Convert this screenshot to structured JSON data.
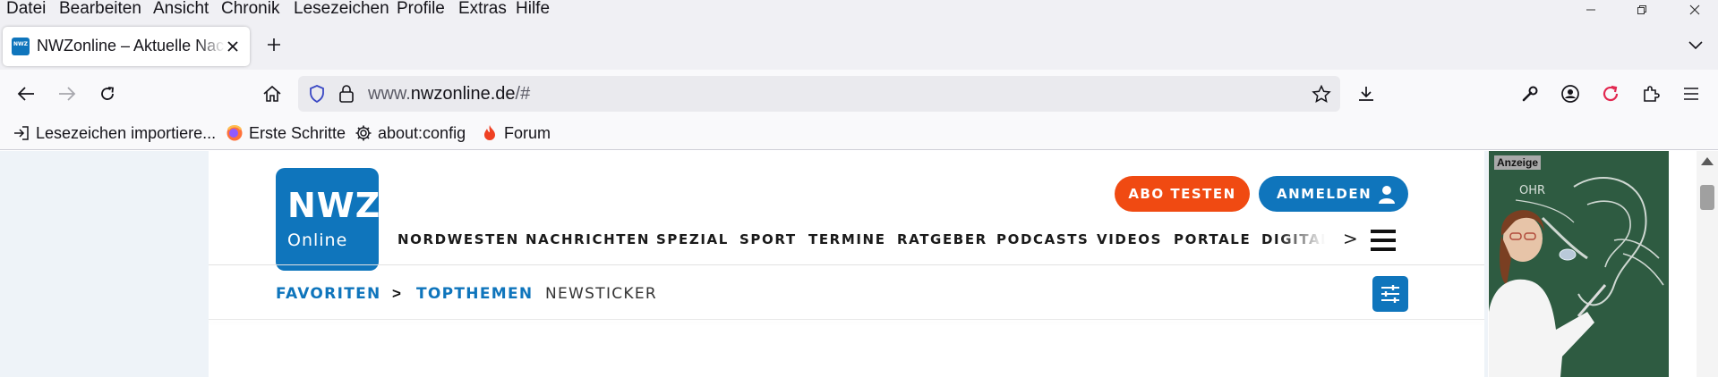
{
  "menubar": {
    "items": [
      "Datei",
      "Bearbeiten",
      "Ansicht",
      "Chronik",
      "Lesezeichen",
      "Profile",
      "Extras",
      "Hilfe"
    ]
  },
  "tab": {
    "title": "NWZonline – Aktuelle Nachrichten",
    "favicon_text": "NWZ"
  },
  "urlbar": {
    "prefix": "www.",
    "host": "nwzonline.de",
    "suffix": "/#"
  },
  "bookmarks": [
    {
      "label": "Lesezeichen importiere...",
      "icon": "import-icon"
    },
    {
      "label": "Erste Schritte",
      "icon": "firefox-icon"
    },
    {
      "label": "about:config",
      "icon": "gear-icon"
    },
    {
      "label": "Forum",
      "icon": "flame-icon"
    }
  ],
  "site": {
    "logo_top": "NWZ",
    "logo_bottom": "Online",
    "abo_button": "ABO TESTEN",
    "login_button": "ANMELDEN",
    "main_nav": [
      "NORDWESTEN",
      "NACHRICHTEN",
      "SPEZIAL",
      "SPORT",
      "TERMINE",
      "RATGEBER",
      "PODCASTS",
      "VIDEOS",
      "PORTALE",
      "DIGITAL"
    ],
    "nav_more": ">",
    "sub_nav": {
      "favorites": "FAVORITEN",
      "chevron": ">",
      "topthemen": "TOPTHEMEN",
      "newsticker": "NEWSTICKER"
    }
  },
  "ad": {
    "label": "Anzeige",
    "chalk_text": "OHR"
  },
  "colors": {
    "brand_blue": "#0f75bc",
    "abo_orange": "#f04a12",
    "chrome_bg": "#f0f0f4"
  }
}
